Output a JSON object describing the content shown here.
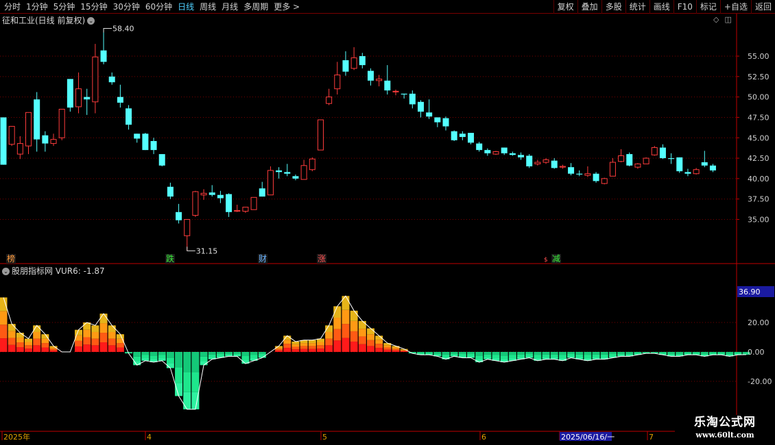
{
  "toolbar": {
    "periods": [
      "分时",
      "1分钟",
      "5分钟",
      "15分钟",
      "30分钟",
      "60分钟",
      "日线",
      "周线",
      "月线",
      "多周期",
      "更多 >"
    ],
    "active_period": "日线",
    "tools": [
      "复权",
      "叠加",
      "多股",
      "统计",
      "画线",
      "F10",
      "标记",
      "+自选",
      "返回"
    ]
  },
  "main_chart": {
    "title": "征和工业(日线 前复权)",
    "price_labels": [
      "55.00",
      "52.50",
      "50.00",
      "47.50",
      "45.00",
      "42.50",
      "40.00",
      "37.50",
      "35.00"
    ],
    "price_levels": [
      55.0,
      52.5,
      50.0,
      47.5,
      45.0,
      42.5,
      40.0,
      37.5,
      35.0
    ],
    "high_label": "58.40",
    "low_label": "31.15",
    "markers": [
      {
        "text": "榜",
        "color": "#ff9a3c"
      },
      {
        "text": "跌",
        "color": "#3cf03c"
      },
      {
        "text": "财",
        "color": "#6ab4ff"
      },
      {
        "text": "涨",
        "color": "#ff5050"
      },
      {
        "text": "减",
        "color": "#3cf03c"
      }
    ]
  },
  "indicator": {
    "title": "股朋指标网 VUR6: -1.87",
    "labels": [
      "36.90",
      "20.00",
      "0.00",
      "-20.00"
    ],
    "current_label": "36.90"
  },
  "time_axis": {
    "labels": [
      "2025年",
      "4",
      "5",
      "6",
      "2025/06/16/一",
      "7"
    ]
  },
  "watermark": {
    "title": "乐淘公式网",
    "url": "www.60lt.com"
  },
  "colors": {
    "up": "#ff3c3c",
    "down": "#54ffff",
    "grid": "#7a0000",
    "axis": "#c00000"
  },
  "chart_data": {
    "type": "candlestick",
    "candles": [
      [
        47.5,
        41.7,
        47.5,
        41.7
      ],
      [
        44.2,
        46.4,
        46.4,
        44.0
      ],
      [
        43.0,
        44.3,
        45.2,
        42.4
      ],
      [
        44.0,
        48.1,
        48.1,
        43.0
      ],
      [
        49.7,
        44.8,
        50.6,
        43.3
      ],
      [
        45.3,
        44.3,
        45.8,
        43.3
      ],
      [
        44.3,
        44.8,
        45.5,
        44.0
      ],
      [
        45.0,
        48.5,
        48.5,
        44.7
      ],
      [
        52.2,
        48.7,
        52.2,
        48.2
      ],
      [
        48.8,
        51.0,
        53.0,
        48.0
      ],
      [
        50.0,
        49.7,
        51.0,
        47.8
      ],
      [
        49.4,
        54.9,
        56.5,
        48.0
      ],
      [
        55.7,
        54.3,
        58.4,
        54.0
      ],
      [
        52.5,
        51.8,
        53.0,
        51.5
      ],
      [
        50.0,
        49.3,
        51.5,
        48.7
      ],
      [
        48.6,
        46.6,
        49.0,
        46.0
      ],
      [
        45.5,
        44.9,
        45.5,
        44.4
      ],
      [
        45.5,
        43.5,
        45.6,
        43.5
      ],
      [
        44.6,
        43.5,
        45.0,
        43.0
      ],
      [
        43.0,
        41.6,
        43.0,
        41.5
      ],
      [
        39.0,
        37.8,
        39.5,
        37.5
      ],
      [
        35.9,
        34.9,
        36.9,
        34.5
      ],
      [
        33.0,
        35.0,
        35.0,
        31.15
      ],
      [
        35.5,
        38.4,
        38.5,
        35.3
      ],
      [
        38.0,
        38.2,
        38.7,
        37.4
      ],
      [
        38.3,
        38.0,
        39.2,
        37.8
      ],
      [
        38.0,
        37.6,
        38.5,
        37.0
      ],
      [
        38.1,
        35.9,
        38.2,
        35.3
      ],
      [
        36.0,
        36.1,
        36.8,
        35.9
      ],
      [
        36.0,
        36.5,
        36.5,
        35.8
      ],
      [
        36.2,
        37.7,
        37.7,
        36.2
      ],
      [
        38.8,
        37.8,
        39.6,
        37.8
      ],
      [
        38.0,
        41.0,
        41.5,
        38.0
      ],
      [
        41.0,
        40.8,
        41.4,
        40.0
      ],
      [
        40.8,
        40.6,
        41.8,
        40.3
      ],
      [
        40.3,
        40.0,
        40.5,
        39.8
      ],
      [
        39.9,
        41.6,
        42.3,
        39.9
      ],
      [
        41.1,
        42.4,
        42.6,
        40.9
      ],
      [
        43.5,
        47.2,
        47.2,
        43.5
      ],
      [
        49.2,
        50.0,
        51.0,
        49.0
      ],
      [
        51.0,
        52.7,
        54.3,
        50.3
      ],
      [
        54.5,
        53.1,
        55.6,
        52.6
      ],
      [
        53.5,
        54.8,
        56.1,
        53.3
      ],
      [
        55.0,
        53.9,
        55.4,
        53.5
      ],
      [
        53.2,
        52.0,
        53.5,
        51.4
      ],
      [
        52.0,
        52.2,
        52.7,
        51.3
      ],
      [
        52.0,
        50.8,
        53.9,
        50.3
      ],
      [
        50.7,
        50.7,
        50.9,
        50.2
      ],
      [
        50.4,
        50.3,
        50.4,
        49.8
      ],
      [
        50.4,
        49.1,
        50.8,
        48.6
      ],
      [
        49.4,
        48.2,
        49.6,
        47.5
      ],
      [
        48.1,
        47.6,
        49.7,
        47.3
      ],
      [
        47.5,
        46.9,
        47.5,
        46.3
      ],
      [
        47.4,
        46.4,
        47.6,
        45.9
      ],
      [
        45.8,
        44.7,
        45.9,
        44.6
      ],
      [
        45.5,
        45.1,
        45.8,
        44.7
      ],
      [
        45.6,
        44.4,
        45.6,
        44.2
      ],
      [
        44.3,
        43.5,
        44.5,
        43.3
      ],
      [
        43.5,
        43.1,
        43.7,
        42.8
      ],
      [
        43.0,
        43.3,
        43.4,
        42.9
      ],
      [
        43.8,
        43.1,
        43.8,
        42.9
      ],
      [
        43.1,
        42.9,
        43.3,
        42.8
      ],
      [
        42.9,
        42.6,
        43.2,
        42.3
      ],
      [
        42.8,
        41.5,
        43.0,
        41.3
      ],
      [
        41.8,
        42.0,
        42.3,
        41.6
      ],
      [
        42.0,
        42.3,
        42.5,
        41.8
      ],
      [
        42.2,
        41.3,
        42.5,
        41.2
      ],
      [
        41.4,
        41.5,
        41.7,
        41.2
      ],
      [
        41.4,
        40.6,
        41.9,
        40.4
      ],
      [
        40.6,
        40.5,
        41.0,
        40.3
      ],
      [
        40.4,
        40.6,
        41.5,
        40.2
      ],
      [
        40.6,
        39.7,
        40.8,
        39.5
      ],
      [
        39.4,
        40.0,
        40.1,
        39.3
      ],
      [
        40.3,
        42.0,
        42.5,
        40.3
      ],
      [
        42.1,
        42.8,
        43.6,
        42.0
      ],
      [
        43.0,
        41.6,
        43.2,
        41.5
      ],
      [
        41.4,
        41.8,
        41.9,
        41.2
      ],
      [
        41.8,
        42.5,
        42.6,
        41.8
      ],
      [
        42.9,
        43.8,
        44.0,
        42.8
      ],
      [
        43.8,
        42.5,
        44.2,
        42.4
      ],
      [
        42.5,
        42.4,
        43.1,
        41.8
      ],
      [
        42.6,
        40.9,
        42.6,
        40.7
      ],
      [
        40.8,
        40.6,
        41.2,
        40.3
      ],
      [
        40.6,
        41.1,
        41.3,
        40.5
      ],
      [
        42.0,
        41.6,
        43.4,
        41.4
      ],
      [
        41.6,
        41.0,
        41.8,
        40.8
      ]
    ],
    "vur6": [
      37,
      19,
      13,
      9,
      18,
      12,
      4,
      0,
      0,
      15,
      20,
      18,
      26,
      18,
      12,
      -1,
      -9,
      -6,
      -7,
      -6,
      -11,
      -30,
      -39,
      -39,
      -9,
      -5,
      -4,
      -3,
      -3,
      -8,
      -6,
      -4,
      0,
      4,
      11,
      7,
      8,
      8,
      9,
      18,
      31,
      38,
      28,
      21,
      16,
      11,
      6,
      4,
      2,
      -1,
      -2,
      -2,
      -3,
      -5,
      -3,
      -4,
      -4,
      -7,
      -5,
      -6,
      -7,
      -6,
      -5,
      -4,
      -6,
      -5,
      -5,
      -6,
      -4,
      -5,
      -6,
      -5,
      -5,
      -4,
      -3,
      -3,
      -2,
      -1,
      -1,
      -2,
      -3,
      -3,
      -2,
      -2,
      -3,
      -2,
      -2,
      -3,
      -2,
      -1.87
    ],
    "price_range": [
      30.0,
      60.0
    ],
    "vur6_range": [
      -55,
      50
    ]
  }
}
